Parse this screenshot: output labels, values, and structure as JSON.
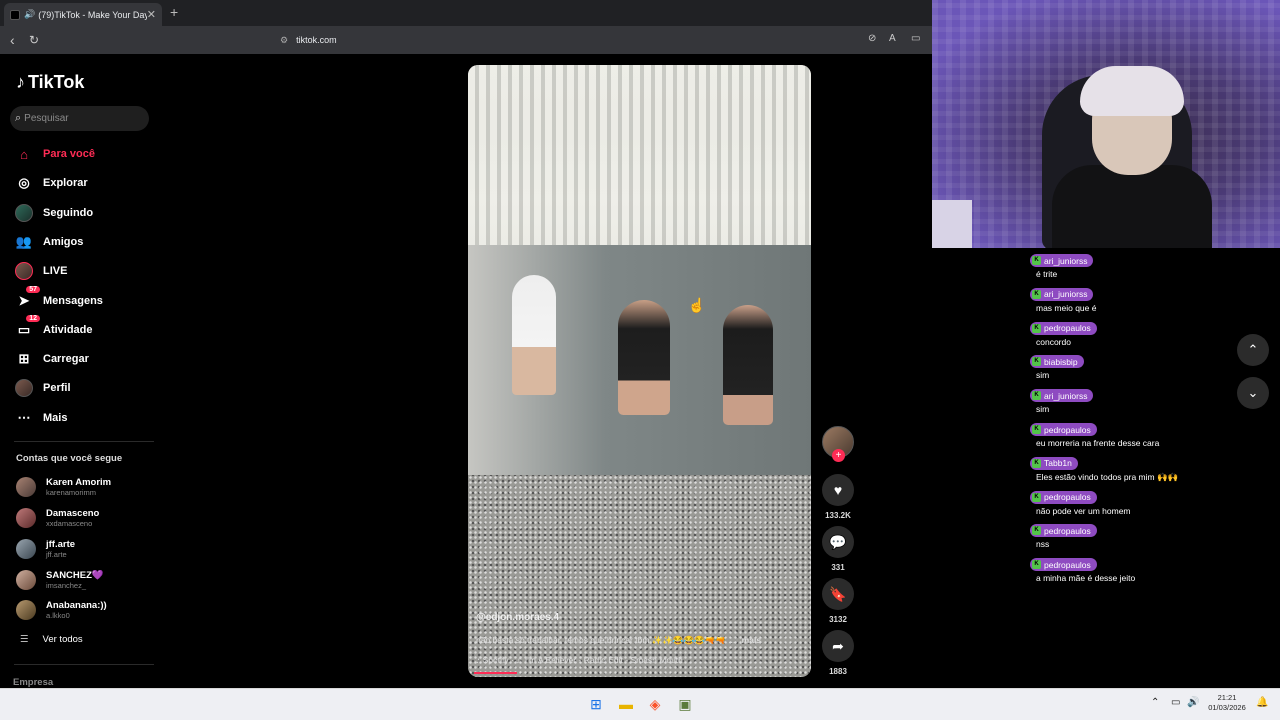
{
  "browser": {
    "tab_title": "(79)TikTok - Make Your Day",
    "tab_close": "✕",
    "new_tab": "+",
    "url": "tiktok.com"
  },
  "tiktok": {
    "logo": "TikTok",
    "search_placeholder": "Pesquisar",
    "nav": [
      {
        "label": "Para você",
        "icon": "home-icon"
      },
      {
        "label": "Explorar",
        "icon": "compass-icon"
      },
      {
        "label": "Seguindo",
        "icon": "avatar-icon"
      },
      {
        "label": "Amigos",
        "icon": "friends-icon"
      },
      {
        "label": "LIVE",
        "icon": "avatar-icon"
      },
      {
        "label": "Mensagens",
        "icon": "messages-icon",
        "badge": "57"
      },
      {
        "label": "Atividade",
        "icon": "activity-icon",
        "badge": "12"
      },
      {
        "label": "Carregar",
        "icon": "upload-icon"
      },
      {
        "label": "Perfil",
        "icon": "avatar-icon"
      },
      {
        "label": "Mais",
        "icon": "more-icon"
      }
    ],
    "following_title": "Contas que você segue",
    "following": [
      {
        "name": "Karen Amorim",
        "handle": "karenamorimm"
      },
      {
        "name": "Damasceno",
        "handle": "xxdamasceno"
      },
      {
        "name": "jff.arte",
        "handle": "jff.arte"
      },
      {
        "name": "SANCHEZ💜",
        "handle": "imsanchez_"
      },
      {
        "name": "Anabanana:))",
        "handle": "a.lkko0"
      }
    ],
    "see_all": "Ver todos",
    "footer": "Empresa"
  },
  "video": {
    "author": "@edjon.moraes.4",
    "description": "não basta só trabalhar, temos que brincar tbm ✨✨😂😂😂🔫🔫 ...",
    "more": "mais",
    "music": "♪ Spotify · ♫ I'm A Believer - Radio Edit - Smash Mouth",
    "progress": 0.13,
    "likes": "133.2K",
    "comments": "331",
    "saves": "3132",
    "shares": "1883"
  },
  "chat": [
    {
      "user": "ari_juniorss",
      "text": "é trite"
    },
    {
      "user": "ari_juniorss",
      "text": "mas meio que é"
    },
    {
      "user": "pedropaulos",
      "text": "concordo"
    },
    {
      "user": "biabisbip",
      "text": "sim"
    },
    {
      "user": "ari_juniorss",
      "text": "sim"
    },
    {
      "user": "pedropaulos",
      "text": "eu morreria na frente desse cara"
    },
    {
      "user": "Tabb1n",
      "text": "Eles estão vindo todos pra mim 🙌🙌"
    },
    {
      "user": "pedropaulos",
      "text": "não pode ver um homem"
    },
    {
      "user": "pedropaulos",
      "text": "nss"
    },
    {
      "user": "pedropaulos",
      "text": "a minha mãe é desse jeito"
    }
  ],
  "taskbar": {
    "time": "21:21",
    "date": "01/03/2026"
  },
  "colors": {
    "accent": "#fe2c55",
    "chat_pill": "#8e4bc1"
  }
}
